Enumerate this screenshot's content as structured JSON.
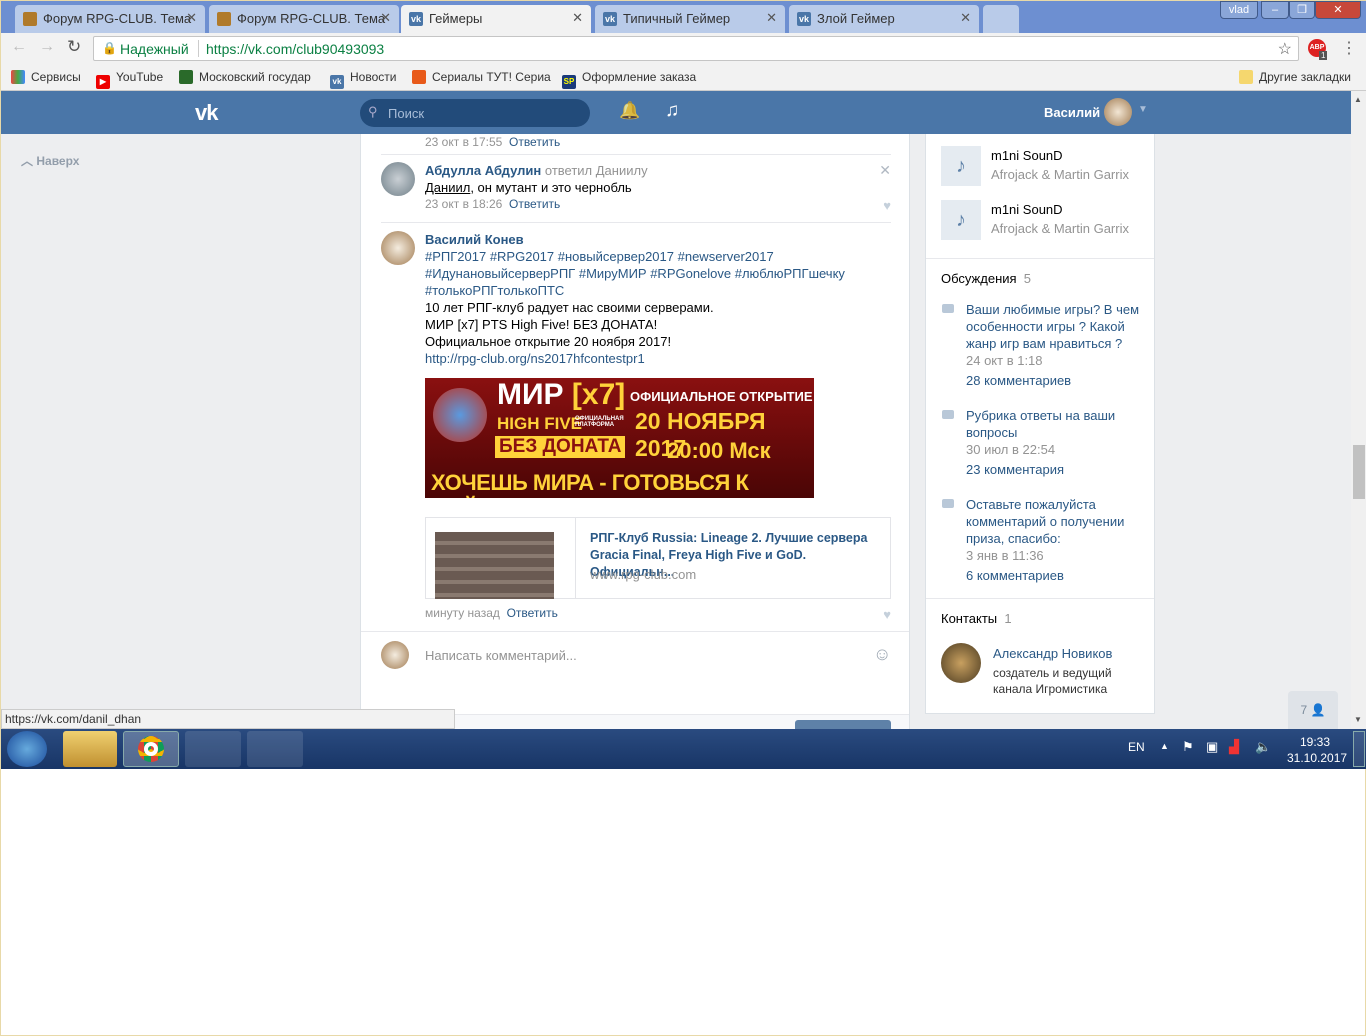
{
  "browser": {
    "tabs": [
      {
        "title": "Форум RPG-CLUB. Тема",
        "icon": "rpg-favicon"
      },
      {
        "title": "Форум RPG-CLUB. Тема",
        "icon": "rpg-favicon"
      },
      {
        "title": "Геймеры",
        "icon": "vk-favicon",
        "active": true
      },
      {
        "title": "Типичный Геймер",
        "icon": "vk-favicon"
      },
      {
        "title": "Злой Геймер",
        "icon": "vk-favicon"
      }
    ],
    "user_badge": "vlad",
    "secure_label": "Надежный",
    "url": "https://vk.com/club90493093",
    "abp_count": "1",
    "bookmarks": [
      {
        "label": "Сервисы",
        "icon": "apps-icon"
      },
      {
        "label": "YouTube",
        "icon": "youtube-icon"
      },
      {
        "label": "Московский государ",
        "icon": "msu-icon"
      },
      {
        "label": "Новости",
        "icon": "vk-icon"
      },
      {
        "label": "Сериалы ТУТ! Сериа",
        "icon": "cat-icon"
      },
      {
        "label": "Оформление заказа",
        "icon": "sp-icon"
      }
    ],
    "other_bookmarks": "Другие закладки",
    "status_url": "https://vk.com/danil_dhan"
  },
  "vk": {
    "search_placeholder": "Поиск",
    "user_name": "Василий",
    "back_to_top": "Наверх",
    "accent": "#4a76a8"
  },
  "comments": {
    "prev_time": "23 окт в 17:55",
    "reply_label": "Ответить",
    "c1": {
      "author": "Абдулла Абдулин",
      "replied": "ответил Даниилу",
      "mention": "Даниил",
      "text": ", он мутант и это чернобль",
      "time": "23 окт в 18:26"
    },
    "c2": {
      "author": "Василий Конев",
      "lines": [
        "#РПГ2017 #RPG2017 #новыйсервер2017 #newserver2017",
        "#ИдунановыйсерверРПГ #МируМИР #RPGonelove #люблюРПГшечку",
        "#толькоРПГтолькоПТС"
      ],
      "body": [
        "10 лет РПГ-клуб радует нас своими серверами.",
        "МИР [x7] PTS High Five! БЕЗ ДОНАТА!",
        "Официальное открытие 20 ноября 2017!"
      ],
      "link": "http://rpg-club.org/ns2017hfcontestpr1",
      "banner": {
        "title": "МИР",
        "rate": "[x7]",
        "sub": "HIGH FIVE",
        "platform": "ОФИЦИАЛЬНАЯ ПЛАТФОРМА",
        "nodonate": "БЕЗ ДОНАТА",
        "opening": "ОФИЦИАЛЬНОЕ ОТКРЫТИЕ",
        "date": "20 НОЯБРЯ 2017",
        "time": "20:00 Мск",
        "slogan": "ХОЧЕШЬ МИРА - ГОТОВЬСЯ К ВОЙНЕ"
      },
      "card": {
        "title": "РПГ-Клуб Russia: Lineage 2. Лучшие сервера Gracia Final, Freya High Five и GoD. Официальн...",
        "domain": "www.rpg-club.com"
      },
      "time": "минуту назад"
    },
    "input_placeholder": "Написать комментарий..."
  },
  "sidebar": {
    "audio": [
      {
        "title": "m1ni SounD",
        "artist": "Afrojack & Martin Garrix"
      },
      {
        "title": "m1ni SounD",
        "artist": "Afrojack & Martin Garrix"
      }
    ],
    "discussions_label": "Обсуждения",
    "discussions_count": "5",
    "discussions": [
      {
        "title": "Ваши любимые игры? В чем особенности игры ? Какой жанр игр вам нравиться ?",
        "date": "24 окт в 1:18",
        "comments": "28 комментариев"
      },
      {
        "title": "Рубрика ответы на ваши вопросы",
        "date": "30 июл в 22:54",
        "comments": "23 комментария"
      },
      {
        "title": "Оставьте пожалуйста комментарий о получении приза, спасибо:",
        "date": "3 янв в 11:36",
        "comments": "6 комментариев"
      }
    ],
    "contacts_label": "Контакты",
    "contacts_count": "1",
    "contact": {
      "name": "Александр Новиков",
      "role": "создатель и ведущий канала Игромистика"
    },
    "online_count": "7"
  },
  "taskbar": {
    "lang": "EN",
    "time": "19:33",
    "date": "31.10.2017"
  }
}
